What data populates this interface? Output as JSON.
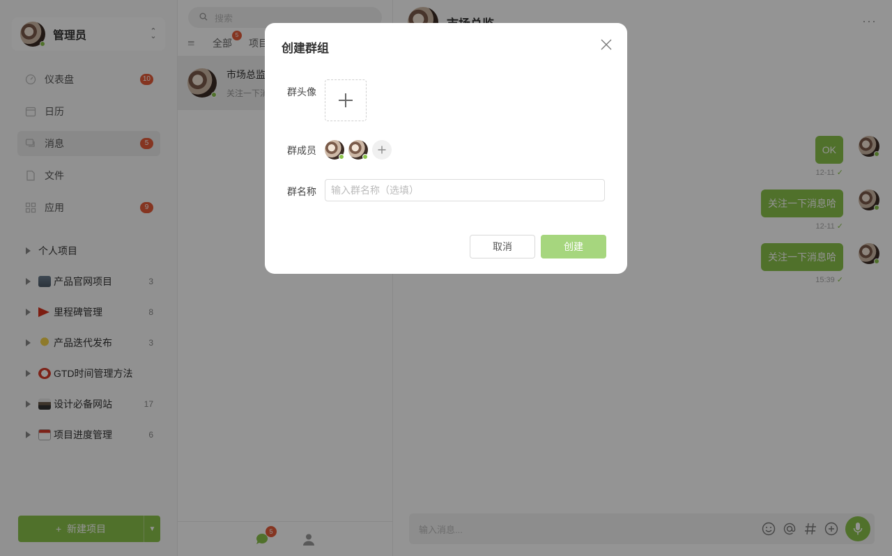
{
  "user": {
    "name": "管理员",
    "status": "online"
  },
  "nav": [
    {
      "label": "仪表盘",
      "badge": "10",
      "icon": "dashboard-icon"
    },
    {
      "label": "日历",
      "badge": "",
      "icon": "calendar-icon"
    },
    {
      "label": "消息",
      "badge": "5",
      "icon": "message-icon",
      "active": true
    },
    {
      "label": "文件",
      "badge": "",
      "icon": "file-icon"
    },
    {
      "label": "应用",
      "badge": "9",
      "icon": "apps-icon"
    }
  ],
  "projects": [
    {
      "label": "个人项目",
      "count": "",
      "emoji": ""
    },
    {
      "label": "产品官网项目",
      "count": "3",
      "emoji": "building-emoji"
    },
    {
      "label": "里程碑管理",
      "count": "8",
      "emoji": "flag-emoji"
    },
    {
      "label": "产品迭代发布",
      "count": "3",
      "emoji": "bulb-emoji"
    },
    {
      "label": "GTD时间管理方法",
      "count": "",
      "emoji": "clock-emoji"
    },
    {
      "label": "设计必备网站",
      "count": "17",
      "emoji": "cabinet-emoji"
    },
    {
      "label": "项目进度管理",
      "count": "6",
      "emoji": "calendar-emoji"
    }
  ],
  "new_project": {
    "label": "新建项目",
    "plus": "+"
  },
  "convlist": {
    "search_placeholder": "搜索",
    "tabs": [
      {
        "label": "全部",
        "badge": "5"
      },
      {
        "label": "项目",
        "badge": ""
      }
    ],
    "conversations": [
      {
        "title": "市场总监",
        "preview": "关注一下消"
      }
    ],
    "bottom_badge": "5"
  },
  "chat": {
    "title": "市场总监",
    "more": "···",
    "messages": [
      {
        "text": "OK",
        "time": "12-11"
      },
      {
        "text": "关注一下消息哈",
        "time": "12-11"
      },
      {
        "text": "关注一下消息哈",
        "time": "15:39"
      }
    ],
    "composer_placeholder": "输入消息..."
  },
  "modal": {
    "title": "创建群组",
    "avatar_label": "群头像",
    "members_label": "群成员",
    "name_label": "群名称",
    "name_placeholder": "输入群名称（选填）",
    "name_value": "",
    "cancel_label": "取消",
    "create_label": "创建"
  },
  "colors": {
    "accent": "#8bc34a",
    "accent_disabled": "#a6d67e",
    "badge": "#e55c3a",
    "overlay": "rgba(0,0,0,0.42)"
  }
}
